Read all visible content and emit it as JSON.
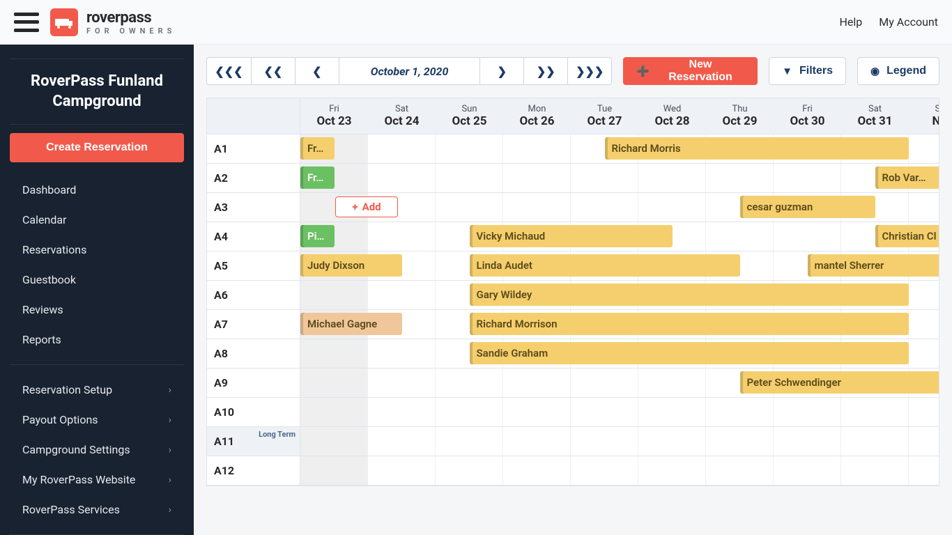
{
  "topbar": {
    "brand": "roverpass",
    "subbrand": "FOR OWNERS",
    "help": "Help",
    "account": "My Account"
  },
  "sidebar": {
    "title": "RoverPass Funland Campground",
    "create_btn": "Create Reservation",
    "nav_primary": [
      "Dashboard",
      "Calendar",
      "Reservations",
      "Guestbook",
      "Reviews",
      "Reports"
    ],
    "nav_secondary": [
      "Reservation Setup",
      "Payout Options",
      "Campground Settings",
      "My RoverPass Website",
      "RoverPass Services"
    ]
  },
  "toolbar": {
    "date": "October 1, 2020",
    "new_res": "New Reservation",
    "filters": "Filters",
    "legend": "Legend",
    "add": "Add"
  },
  "dates": [
    {
      "dow": "Fri",
      "dom": "Oct 23"
    },
    {
      "dow": "Sat",
      "dom": "Oct 24"
    },
    {
      "dow": "Sun",
      "dom": "Oct 25"
    },
    {
      "dow": "Mon",
      "dom": "Oct 26"
    },
    {
      "dow": "Tue",
      "dom": "Oct 27"
    },
    {
      "dow": "Wed",
      "dom": "Oct 28"
    },
    {
      "dow": "Thu",
      "dom": "Oct 29"
    },
    {
      "dow": "Fri",
      "dom": "Oct 30"
    },
    {
      "dow": "Sat",
      "dom": "Oct 31"
    },
    {
      "dow": "Sun",
      "dom": "Nov"
    }
  ],
  "sites": [
    "A1",
    "A2",
    "A3",
    "A4",
    "A5",
    "A6",
    "A7",
    "A8",
    "A9",
    "A10",
    "A11",
    "A12"
  ],
  "long_term_label": "Long Term",
  "reservations": {
    "r1a": "Fr…",
    "r1b": "Richard Morris",
    "r2a": "Fr…",
    "r2b": "Rob Var…",
    "r3a": "cesar guzman",
    "r4a": "Pi…",
    "r4b": "Vicky Michaud",
    "r4c": "Christian Cl",
    "r5a": "Judy Dixson",
    "r5b": "Linda Audet",
    "r5c": "mantel Sherrer",
    "r6a": "Gary Wildey",
    "r7a": "Michael Gagne",
    "r7b": "Richard Morrison",
    "r8a": "Sandie Graham",
    "r9a": "Peter Schwendinger"
  }
}
